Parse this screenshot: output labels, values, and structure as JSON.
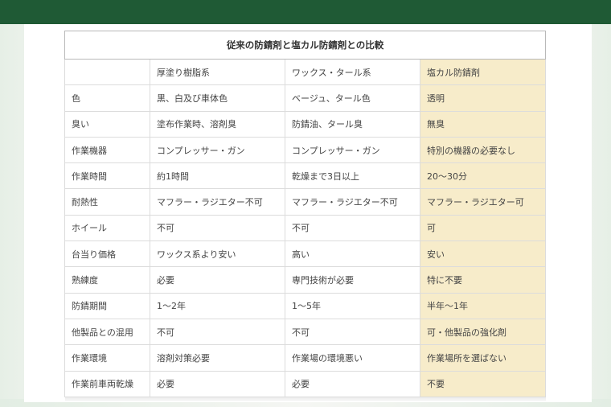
{
  "table": {
    "title": "従来の防錆剤と塩カル防錆剤との比較",
    "columns": [
      "",
      "厚塗り樹脂系",
      "ワックス・タール系",
      "塩カル防錆剤"
    ],
    "rows": [
      [
        "色",
        "黒、白及び車体色",
        "ベージュ、タール色",
        "透明"
      ],
      [
        "臭い",
        "塗布作業時、溶剤臭",
        "防錆油、タール臭",
        "無臭"
      ],
      [
        "作業機器",
        "コンプレッサー・ガン",
        "コンプレッサー・ガン",
        "特別の機器の必要なし"
      ],
      [
        "作業時間",
        "約1時間",
        "乾燥まで3日以上",
        "20～30分"
      ],
      [
        "耐熱性",
        "マフラー・ラジエター不可",
        "マフラー・ラジエター不可",
        "マフラー・ラジエター可"
      ],
      [
        "ホイール",
        "不可",
        "不可",
        "可"
      ],
      [
        "台当り価格",
        "ワックス系より安い",
        "高い",
        "安い"
      ],
      [
        "熟練度",
        "必要",
        "専門技術が必要",
        "特に不要"
      ],
      [
        "防錆期間",
        "1～2年",
        "1～5年",
        "半年～1年"
      ],
      [
        "他製品との混用",
        "不可",
        "不可",
        "可・他製品の強化剤"
      ],
      [
        "作業環境",
        "溶剤対策必要",
        "作業場の環境悪い",
        "作業場所を選ばない"
      ],
      [
        "作業前車両乾燥",
        "必要",
        "必要",
        "不要"
      ]
    ]
  },
  "colors": {
    "header_bar": "#1f5a35",
    "highlight_column": "#f7ecca"
  }
}
